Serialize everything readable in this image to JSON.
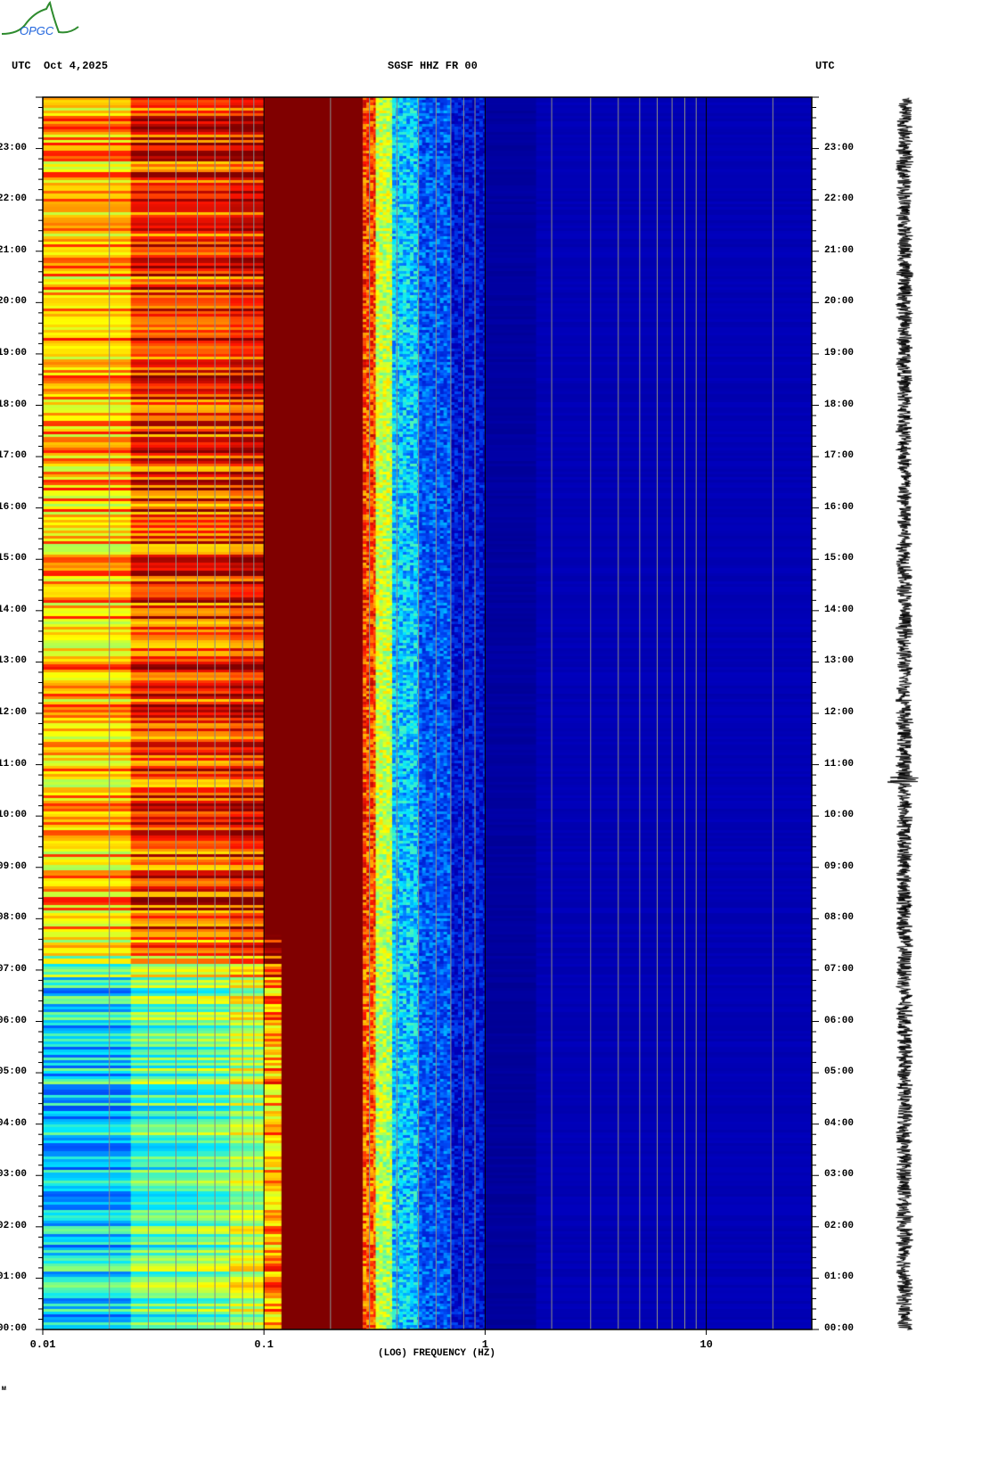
{
  "header": {
    "logo_text": "OPGC",
    "left_label": "UTC  Oct 4,2025",
    "station": "SGSF HHZ FR 00",
    "right_label": "UTC"
  },
  "footer_mark": "ᴍ",
  "colors": {
    "low": "#00008a",
    "background_blue": "#0000b4",
    "high": "#800000",
    "grid_minor": "#8a8a8a",
    "grid_major": "#000000"
  },
  "chart_data": {
    "type": "heatmap",
    "title": "SGSF HHZ FR 00",
    "xlabel": "(LOG) FREQUENCY (HZ)",
    "ylabel": "UTC",
    "xscale": "log",
    "xlim": [
      0.01,
      30
    ],
    "ylim_hours": [
      0,
      24
    ],
    "x_ticks": [
      {
        "value": 0.01,
        "label": "0.01"
      },
      {
        "value": 0.1,
        "label": "0.1"
      },
      {
        "value": 1,
        "label": "1"
      },
      {
        "value": 10,
        "label": "10"
      }
    ],
    "y_ticks": [
      "00:00",
      "01:00",
      "02:00",
      "03:00",
      "04:00",
      "05:00",
      "06:00",
      "07:00",
      "08:00",
      "09:00",
      "10:00",
      "11:00",
      "12:00",
      "13:00",
      "14:00",
      "15:00",
      "16:00",
      "17:00",
      "18:00",
      "19:00",
      "20:00",
      "21:00",
      "22:00",
      "23:00"
    ],
    "intensity_scale": "0 = dark blue (low power) to 1 = dark red (high power)",
    "bands": [
      {
        "f_low": 0.01,
        "f_high": 0.025,
        "night_00_07": 0.42,
        "day_07_24": 0.74
      },
      {
        "f_low": 0.025,
        "f_high": 0.05,
        "night_00_07": 0.52,
        "day_07_24": 0.86
      },
      {
        "f_low": 0.05,
        "f_high": 0.07,
        "night_00_07": 0.55,
        "day_07_24": 0.86
      },
      {
        "f_low": 0.07,
        "f_high": 0.1,
        "night_00_07": 0.62,
        "day_07_24": 0.9
      },
      {
        "f_low": 0.1,
        "f_high": 0.12,
        "night_00_07": 0.76,
        "day_07_24": 1.0
      },
      {
        "f_low": 0.12,
        "f_high": 0.28,
        "night_00_07": 1.0,
        "day_07_24": 1.0
      },
      {
        "f_low": 0.28,
        "f_high": 0.32,
        "night_00_07": 0.82,
        "day_07_24": 0.85
      },
      {
        "f_low": 0.32,
        "f_high": 0.38,
        "night_00_07": 0.6,
        "day_07_24": 0.62
      },
      {
        "f_low": 0.38,
        "f_high": 0.5,
        "night_00_07": 0.4,
        "day_07_24": 0.4
      },
      {
        "f_low": 0.5,
        "f_high": 0.7,
        "night_00_07": 0.28,
        "day_07_24": 0.28
      },
      {
        "f_low": 0.7,
        "f_high": 1.0,
        "night_00_07": 0.17,
        "day_07_24": 0.17
      },
      {
        "f_low": 1.0,
        "f_high": 1.7,
        "night_00_07": 0.04,
        "day_07_24": 0.05
      },
      {
        "f_low": 1.7,
        "f_high": 30,
        "night_00_07": 0.1,
        "day_07_24": 0.1
      }
    ],
    "seismogram": {
      "channel": "HHZ",
      "notable_spike_hour": 10.7
    }
  }
}
